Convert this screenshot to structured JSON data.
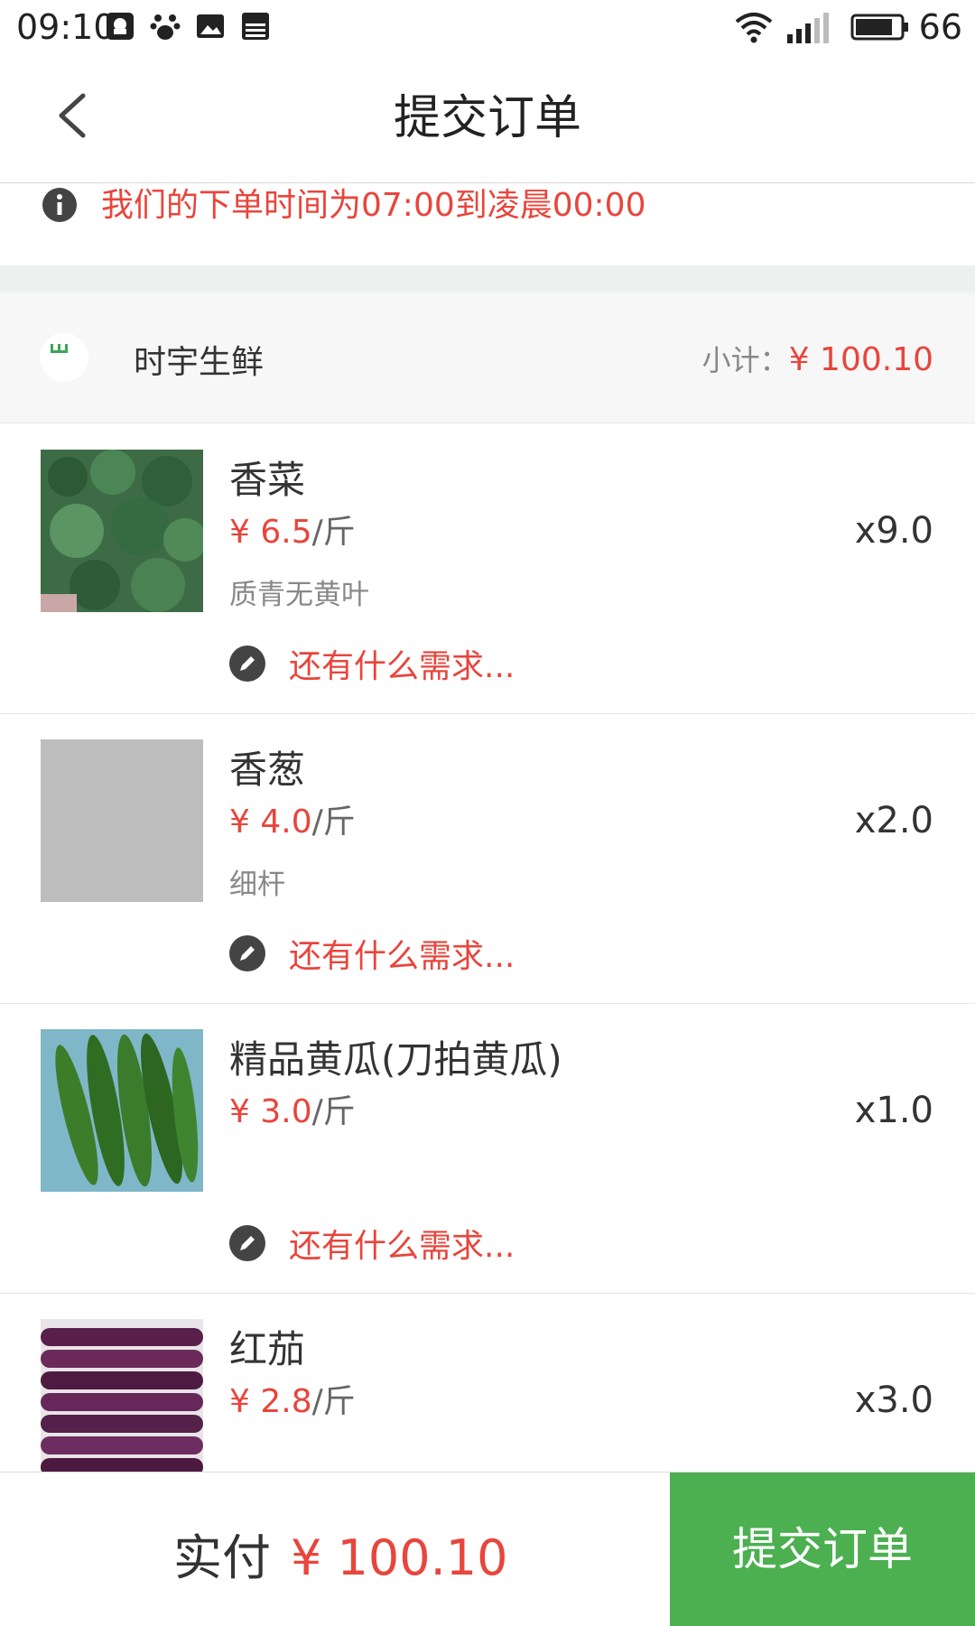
{
  "status_bar": {
    "time": "09:10",
    "battery": "66"
  },
  "header": {
    "title": "提交订单"
  },
  "notice": {
    "text": "我们的下单时间为07:00到凌晨00:00"
  },
  "shop": {
    "name": "时宇生鲜",
    "subtotal_label": "小计：",
    "subtotal_value": "¥ 100.10"
  },
  "items": [
    {
      "name": "香菜",
      "price": "¥ 6.5",
      "unit": "/斤",
      "desc": "质青无黄叶",
      "qty": "x9.0",
      "note": "还有什么需求..."
    },
    {
      "name": "香葱",
      "price": "¥ 4.0",
      "unit": "/斤",
      "desc": "细杆",
      "qty": "x2.0",
      "note": "还有什么需求..."
    },
    {
      "name": "精品黄瓜(刀拍黄瓜)",
      "price": "¥ 3.0",
      "unit": "/斤",
      "desc": "",
      "qty": "x1.0",
      "note": "还有什么需求..."
    },
    {
      "name": "红茄",
      "price": "¥ 2.8",
      "unit": "/斤",
      "desc": "",
      "qty": "x3.0",
      "note": ""
    }
  ],
  "footer": {
    "pay_label": "实付",
    "pay_value": "¥ 100.10",
    "submit_label": "提交订单"
  },
  "colors": {
    "accent_red": "#e8453c",
    "button_green": "#4caf50"
  }
}
